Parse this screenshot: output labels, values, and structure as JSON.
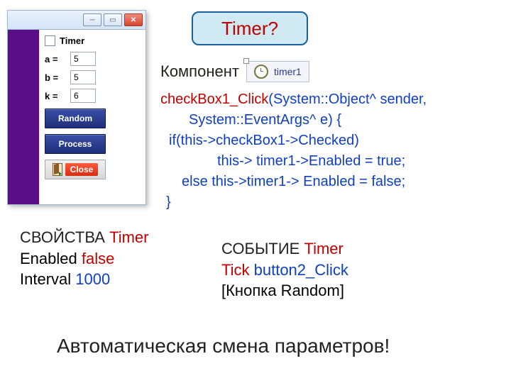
{
  "badge": {
    "text": "Timer?"
  },
  "window": {
    "checkbox_label": "Timer",
    "fields": {
      "a_label": "a =",
      "a_value": "5",
      "b_label": "b =",
      "b_value": "5",
      "k_label": "k =",
      "k_value": "6"
    },
    "buttons": {
      "random": "Random",
      "process": "Process",
      "close": "Close"
    }
  },
  "component": {
    "label": "Компонент",
    "chip_text": "timer1"
  },
  "code": {
    "line1_fn": "checkBox1_Click",
    "line1_args": "(System::Object^  sender,",
    "line2": "System::EventArgs^  e) {",
    "line3": "if(this->checkBox1->Checked)",
    "line4": "this-> timer1->Enabled = true;",
    "line5": "else this->timer1-> Enabled = false;",
    "line6": "}"
  },
  "properties": {
    "header": "СВОЙСТВА ",
    "name": "Timer",
    "enabled_label": "Enabled ",
    "enabled_value": "false",
    "interval_label": "Interval  ",
    "interval_value": "1000"
  },
  "events": {
    "header": "СОБЫТИЕ ",
    "name": "Timer",
    "event_label": "Tick ",
    "event_handler": "button2_Click",
    "note": "[Кнопка Random]"
  },
  "bottom": "Автоматическая смена параметров!"
}
